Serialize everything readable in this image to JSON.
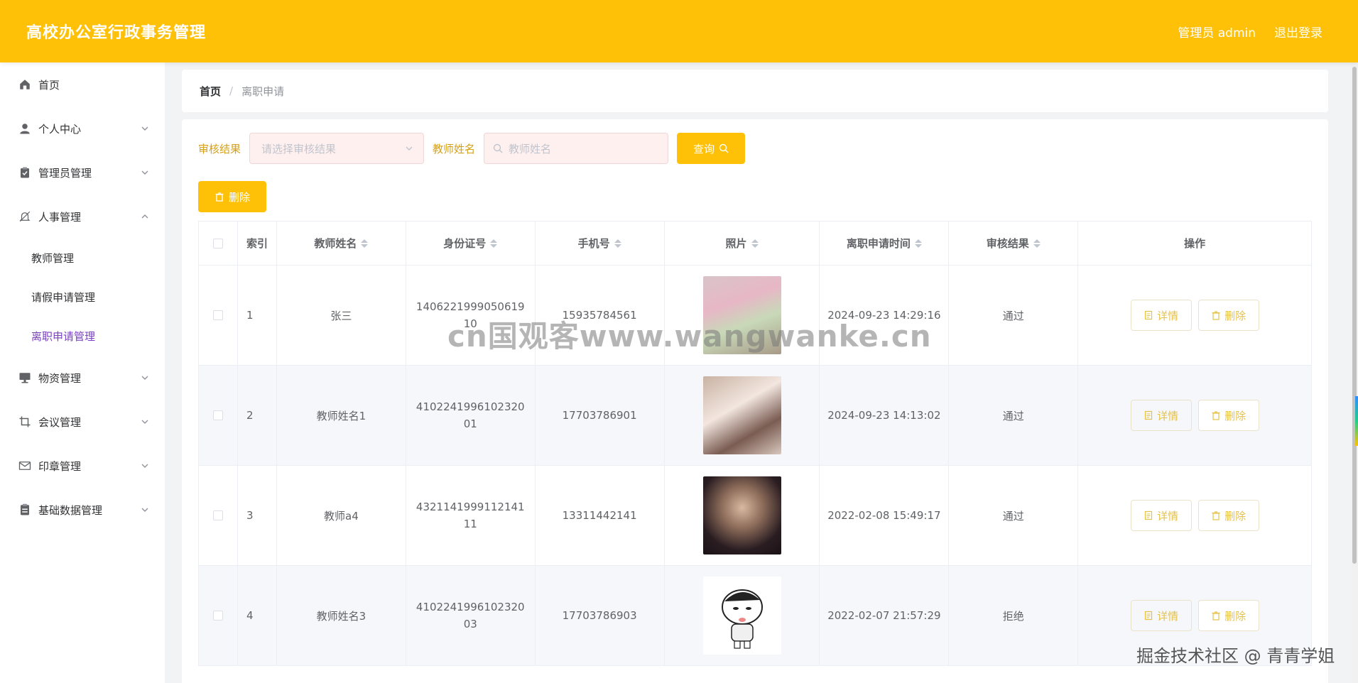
{
  "header": {
    "app_title": "高校办公室行政事务管理",
    "user_label": "管理员 admin",
    "logout_label": "退出登录"
  },
  "sidebar": {
    "items": [
      {
        "label": "首页",
        "icon": "home-icon"
      },
      {
        "label": "个人中心",
        "icon": "user-icon"
      },
      {
        "label": "管理员管理",
        "icon": "clipboard-icon"
      },
      {
        "label": "人事管理",
        "icon": "bell-off-icon"
      },
      {
        "label": "物资管理",
        "icon": "monitor-icon"
      },
      {
        "label": "会议管理",
        "icon": "crop-icon"
      },
      {
        "label": "印章管理",
        "icon": "mail-icon"
      },
      {
        "label": "基础数据管理",
        "icon": "list-icon"
      }
    ],
    "sub_items": [
      {
        "label": "教师管理"
      },
      {
        "label": "请假申请管理"
      },
      {
        "label": "离职申请管理"
      }
    ],
    "active_color": "#7a3fbf"
  },
  "breadcrumb": {
    "home": "首页",
    "sep": "/",
    "current": "离职申请"
  },
  "search": {
    "result_label": "审核结果",
    "result_placeholder": "请选择审核结果",
    "name_label": "教师姓名",
    "name_placeholder": "教师姓名",
    "query_label": "查询",
    "delete_label": "删除"
  },
  "table": {
    "headers": [
      "索引",
      "教师姓名",
      "身份证号",
      "手机号",
      "照片",
      "离职申请时间",
      "审核结果",
      "操作"
    ],
    "rows": [
      {
        "index": "1",
        "name": "张三",
        "id": "140622199905061910",
        "phone": "15935784561",
        "time": "2024-09-23 14:29:16",
        "result": "通过"
      },
      {
        "index": "2",
        "name": "教师姓名1",
        "id": "410224199610232001",
        "phone": "17703786901",
        "time": "2024-09-23 14:13:02",
        "result": "通过"
      },
      {
        "index": "3",
        "name": "教师a4",
        "id": "432114199911214111",
        "phone": "13311442141",
        "time": "2022-02-08 15:49:17",
        "result": "通过"
      },
      {
        "index": "4",
        "name": "教师姓名3",
        "id": "410224199610232003",
        "phone": "17703786903",
        "time": "2022-02-07 21:57:29",
        "result": "拒绝"
      }
    ],
    "detail_label": "详情",
    "delete_label": "删除"
  },
  "watermark": "cn国观客www.wangwanke.cn",
  "watermark_corner": "掘金技术社区 @ 青青学姐",
  "colors": {
    "brand": "#fec107",
    "label": "#d4a017"
  }
}
